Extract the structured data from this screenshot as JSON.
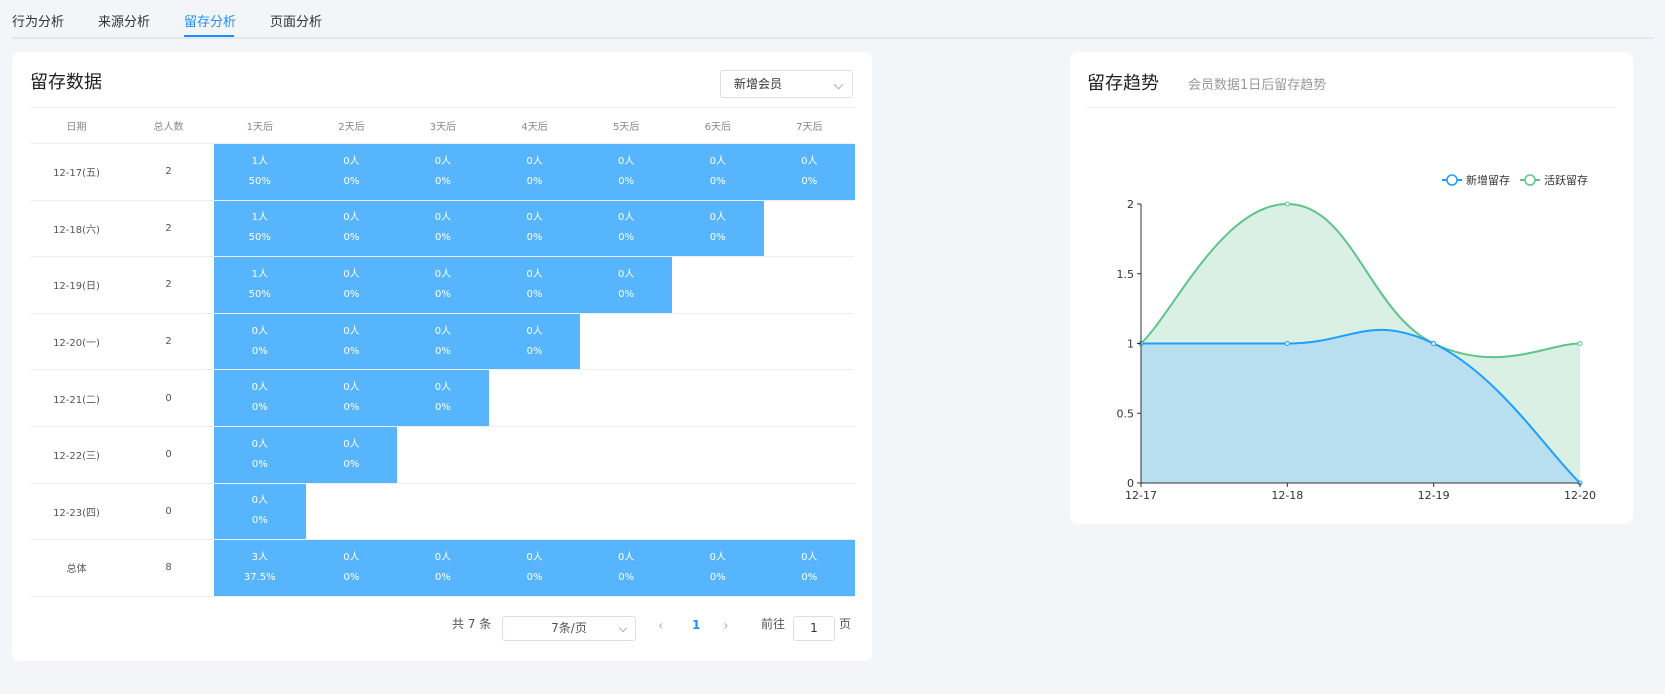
{
  "tabs": [
    {
      "label": "行为分析"
    },
    {
      "label": "来源分析"
    },
    {
      "label": "留存分析",
      "active": true
    },
    {
      "label": "页面分析"
    }
  ],
  "retention": {
    "title": "留存数据",
    "select_value": "新增会员",
    "headers": [
      "日期",
      "总人数",
      "1天后",
      "2天后",
      "3天后",
      "4天后",
      "5天后",
      "6天后",
      "7天后"
    ],
    "rows": [
      {
        "date": "12-17(五)",
        "total": "2",
        "cells": [
          [
            "1人",
            "50%"
          ],
          [
            "0人",
            "0%"
          ],
          [
            "0人",
            "0%"
          ],
          [
            "0人",
            "0%"
          ],
          [
            "0人",
            "0%"
          ],
          [
            "0人",
            "0%"
          ],
          [
            "0人",
            "0%"
          ]
        ]
      },
      {
        "date": "12-18(六)",
        "total": "2",
        "cells": [
          [
            "1人",
            "50%"
          ],
          [
            "0人",
            "0%"
          ],
          [
            "0人",
            "0%"
          ],
          [
            "0人",
            "0%"
          ],
          [
            "0人",
            "0%"
          ],
          [
            "0人",
            "0%"
          ]
        ]
      },
      {
        "date": "12-19(日)",
        "total": "2",
        "cells": [
          [
            "1人",
            "50%"
          ],
          [
            "0人",
            "0%"
          ],
          [
            "0人",
            "0%"
          ],
          [
            "0人",
            "0%"
          ],
          [
            "0人",
            "0%"
          ]
        ]
      },
      {
        "date": "12-20(一)",
        "total": "2",
        "cells": [
          [
            "0人",
            "0%"
          ],
          [
            "0人",
            "0%"
          ],
          [
            "0人",
            "0%"
          ],
          [
            "0人",
            "0%"
          ]
        ]
      },
      {
        "date": "12-21(二)",
        "total": "0",
        "cells": [
          [
            "0人",
            "0%"
          ],
          [
            "0人",
            "0%"
          ],
          [
            "0人",
            "0%"
          ]
        ]
      },
      {
        "date": "12-22(三)",
        "total": "0",
        "cells": [
          [
            "0人",
            "0%"
          ],
          [
            "0人",
            "0%"
          ]
        ]
      },
      {
        "date": "12-23(四)",
        "total": "0",
        "cells": [
          [
            "0人",
            "0%"
          ]
        ]
      },
      {
        "date": "总体",
        "total": "8",
        "cells": [
          [
            "3人",
            "37.5%"
          ],
          [
            "0人",
            "0%"
          ],
          [
            "0人",
            "0%"
          ],
          [
            "0人",
            "0%"
          ],
          [
            "0人",
            "0%"
          ],
          [
            "0人",
            "0%"
          ],
          [
            "0人",
            "0%"
          ]
        ]
      }
    ],
    "fill_color": "#56b5fc"
  },
  "pagination": {
    "total_text": "共 7 条",
    "page_size": "7条/页",
    "current_page": "1",
    "goto_label": "前往",
    "goto_value": "1",
    "page_suffix": "页"
  },
  "trend": {
    "title": "留存趋势",
    "subtitle": "会员数据1日后留存趋势"
  },
  "chart_data": {
    "type": "area",
    "categories": [
      "12-17",
      "12-18",
      "12-19",
      "12-20"
    ],
    "series": [
      {
        "name": "新增留存",
        "values": [
          1,
          1,
          1,
          0
        ],
        "color": "#1e9fff",
        "fill": "#b8dff0"
      },
      {
        "name": "活跃留存",
        "values": [
          1,
          2,
          1,
          1
        ],
        "color": "#5fc48b",
        "fill": "#daf0e5"
      }
    ],
    "yticks": [
      "0",
      "0.5",
      "1",
      "1.5",
      "2"
    ],
    "ylim": [
      0,
      2
    ],
    "smooth": true,
    "legend_position": "top-right"
  }
}
